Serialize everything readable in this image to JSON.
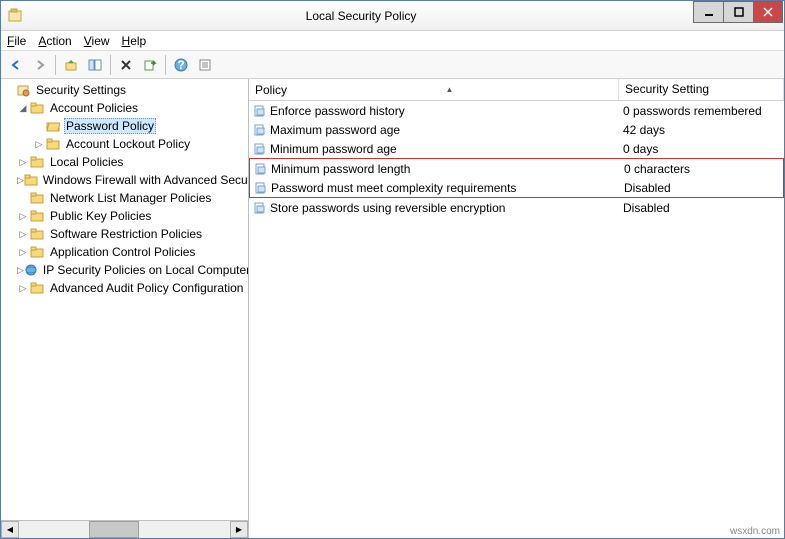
{
  "window": {
    "title": "Local Security Policy"
  },
  "menu": {
    "file": "File",
    "action": "Action",
    "view": "View",
    "help": "Help"
  },
  "tree": {
    "root": "Security Settings",
    "account_policies": "Account Policies",
    "password_policy": "Password Policy",
    "account_lockout": "Account Lockout Policy",
    "local_policies": "Local Policies",
    "firewall": "Windows Firewall with Advanced Security",
    "network_list": "Network List Manager Policies",
    "public_key": "Public Key Policies",
    "software_restriction": "Software Restriction Policies",
    "app_control": "Application Control Policies",
    "ip_security": "IP Security Policies on Local Computer",
    "advanced_audit": "Advanced Audit Policy Configuration"
  },
  "list": {
    "col_policy": "Policy",
    "col_setting": "Security Setting",
    "rows": [
      {
        "policy": "Enforce password history",
        "setting": "0 passwords remembered"
      },
      {
        "policy": "Maximum password age",
        "setting": "42 days"
      },
      {
        "policy": "Minimum password age",
        "setting": "0 days"
      },
      {
        "policy": "Minimum password length",
        "setting": "0 characters"
      },
      {
        "policy": "Password must meet complexity requirements",
        "setting": "Disabled"
      },
      {
        "policy": "Store passwords using reversible encryption",
        "setting": "Disabled"
      }
    ]
  },
  "watermark": "wsxdn.com"
}
